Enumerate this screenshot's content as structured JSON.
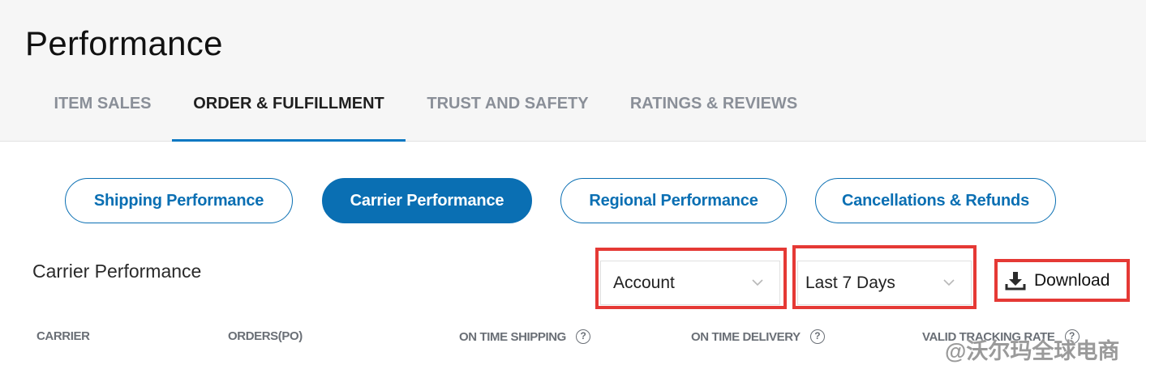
{
  "header": {
    "title": "Performance",
    "tabs": [
      {
        "label": "ITEM SALES",
        "active": false
      },
      {
        "label": "ORDER & FULFILLMENT",
        "active": true
      },
      {
        "label": "TRUST AND SAFETY",
        "active": false
      },
      {
        "label": "RATINGS & REVIEWS",
        "active": false
      }
    ]
  },
  "subnav": {
    "pills": [
      {
        "label": "Shipping Performance",
        "active": false
      },
      {
        "label": "Carrier Performance",
        "active": true
      },
      {
        "label": "Regional Performance",
        "active": false
      },
      {
        "label": "Cancellations & Refunds",
        "active": false
      }
    ]
  },
  "section": {
    "title": "Carrier Performance",
    "account_select": {
      "value": "Account"
    },
    "range_select": {
      "value": "Last 7 Days"
    },
    "download_label": "Download"
  },
  "table": {
    "columns": [
      {
        "label": "CARRIER",
        "help": false
      },
      {
        "label": "ORDERS(PO)",
        "help": false
      },
      {
        "label": "ON TIME SHIPPING",
        "help": true
      },
      {
        "label": "ON TIME DELIVERY",
        "help": true
      },
      {
        "label": "VALID TRACKING RATE",
        "help": true
      }
    ]
  },
  "watermark": "@沃尔玛全球电商",
  "colors": {
    "accent": "#0a6fb3",
    "tab_underline": "#0a78c2",
    "highlight_border": "#e53935",
    "header_bg": "#f6f6f6"
  },
  "icons": {
    "chevron": "chevron-down-icon",
    "download": "download-icon",
    "help": "help-circle-icon"
  }
}
